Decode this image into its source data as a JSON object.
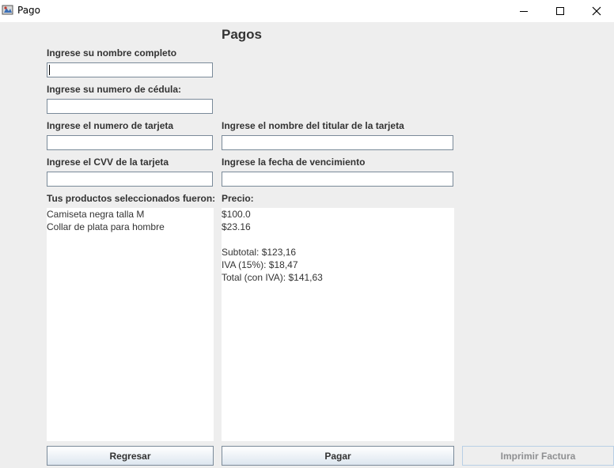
{
  "window": {
    "title": "Pago"
  },
  "form": {
    "heading": "Pagos",
    "name_label": "Ingrese su nombre completo",
    "name_value": "",
    "id_label": "Ingrese su numero de cédula:",
    "id_value": "",
    "card_number_label": "Ingrese el numero de tarjeta",
    "card_number_value": "",
    "card_holder_label": "Ingrese el nombre del titular de la tarjeta",
    "card_holder_value": "",
    "cvv_label": "Ingrese el CVV de la tarjeta",
    "cvv_value": "",
    "expiry_label": "Ingrese la fecha de vencimiento",
    "expiry_value": ""
  },
  "products": {
    "label": "Tus productos seleccionados fueron:",
    "items": [
      "Camiseta negra talla M",
      "Collar de plata para hombre"
    ]
  },
  "prices": {
    "label": "Precio:",
    "items": [
      "$100.0",
      "$23.16"
    ],
    "subtotal": "Subtotal: $123,16",
    "iva": "IVA (15%): $18,47",
    "total": "Total (con IVA): $141,63"
  },
  "buttons": {
    "back": "Regresar",
    "pay": "Pagar",
    "print_invoice": "Imprimir Factura",
    "print_invoice_enabled": false
  }
}
